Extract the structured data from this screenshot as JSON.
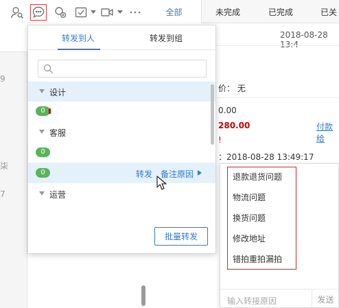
{
  "tabs": [
    "全部",
    "未完成",
    "已完成",
    "已关"
  ],
  "left_strip": {
    "fragments": [
      "9",
      "柒",
      "7"
    ]
  },
  "background": {
    "date1": "2018-08-28 13:4",
    "price_label": "价： 无",
    "amount1": "0.00",
    "amount2": "280.00",
    "pay_link": "付款给",
    "date2": "：2018-08-28 13:49:17",
    "frag_exclaim": "!"
  },
  "popup": {
    "tab_person": "转发到人",
    "tab_group": "转发到组",
    "search_placeholder": "",
    "groups": [
      "设计",
      "客服",
      "运营"
    ],
    "badges": [
      "0",
      "0",
      "0"
    ],
    "row_forward": "转发",
    "row_note": "备注原因",
    "batch_button": "批量转发"
  },
  "reason": {
    "items": [
      "退款退货问题",
      "物流问题",
      "换货问题",
      "修改地址",
      "错拍重拍漏拍"
    ],
    "input_placeholder": "输入转接原因",
    "send": "发送"
  },
  "colors": {
    "accent": "#2f7ad1",
    "highlight": "#e4f1fb",
    "badge": "#5bb35b",
    "alert": "#c9252c"
  },
  "icons": [
    "user-search-icon",
    "forward-chat-icon",
    "transfer-icon",
    "checklist-icon",
    "video-icon",
    "more-icon"
  ]
}
